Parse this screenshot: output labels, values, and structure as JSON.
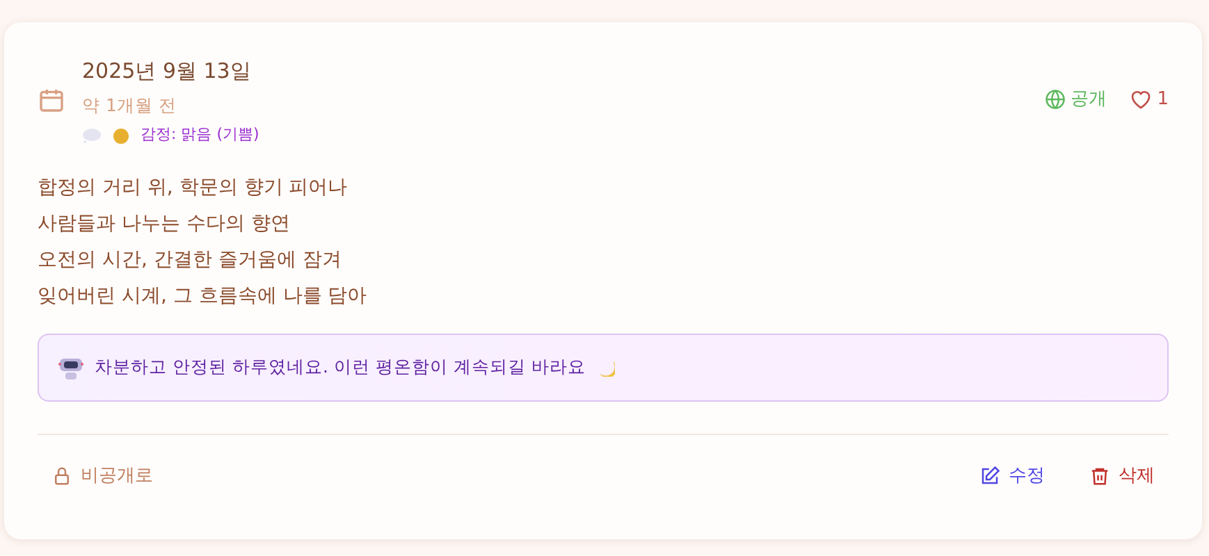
{
  "entry": {
    "date": "2025년 9월 13일",
    "relative_time": "약 1개월 전",
    "emotion": "감정: 맑음 (기쁨)",
    "visibility": "공개",
    "likes": "1",
    "liked": false,
    "lines": [
      "합정의 거리 위, 학문의 향기 피어나",
      "사람들과 나누는 수다의 향연",
      "오전의 시간, 간결한 즐거움에 잠겨",
      "잊어버린 시계, 그 흐름속에 나를 담아"
    ],
    "ai_comment": "차분하고 안정된 하루였네요. 이런 평온함이 계속되길 바라요",
    "actions": [
      {
        "kind": "privacy",
        "label": "비공개로"
      },
      {
        "kind": "edit",
        "label": "수정"
      },
      {
        "kind": "delete",
        "label": "삭제"
      }
    ]
  }
}
